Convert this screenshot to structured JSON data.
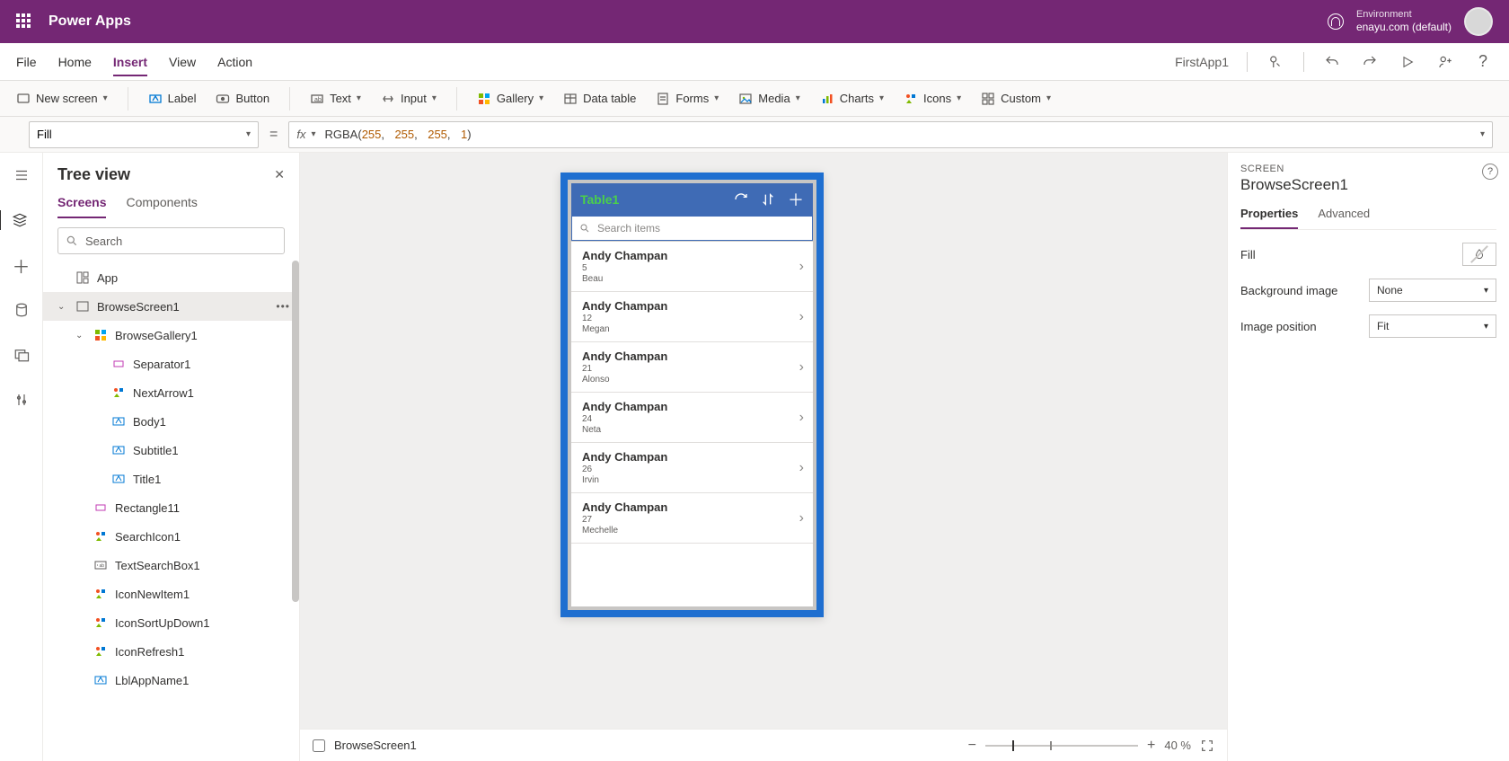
{
  "header": {
    "product": "Power Apps",
    "env_label": "Environment",
    "env_value": "enayu.com (default)"
  },
  "menubar": {
    "items": [
      "File",
      "Home",
      "Insert",
      "View",
      "Action"
    ],
    "active": "Insert",
    "app_name": "FirstApp1"
  },
  "ribbon": {
    "new_screen": "New screen",
    "label": "Label",
    "button": "Button",
    "text": "Text",
    "input": "Input",
    "gallery": "Gallery",
    "data_table": "Data table",
    "forms": "Forms",
    "media": "Media",
    "charts": "Charts",
    "icons": "Icons",
    "custom": "Custom"
  },
  "formula": {
    "property": "Fill",
    "fn": "RGBA",
    "args": [
      "255",
      "255",
      "255",
      "1"
    ]
  },
  "tree": {
    "title": "Tree view",
    "tabs": {
      "screens": "Screens",
      "components": "Components"
    },
    "search_placeholder": "Search",
    "items": [
      {
        "label": "App",
        "depth": 0,
        "icon": "app"
      },
      {
        "label": "BrowseScreen1",
        "depth": 0,
        "icon": "screen",
        "expandable": true,
        "selected": true,
        "more": true
      },
      {
        "label": "BrowseGallery1",
        "depth": 1,
        "icon": "gallery",
        "expandable": true
      },
      {
        "label": "Separator1",
        "depth": 2,
        "icon": "rect"
      },
      {
        "label": "NextArrow1",
        "depth": 2,
        "icon": "icons"
      },
      {
        "label": "Body1",
        "depth": 2,
        "icon": "label"
      },
      {
        "label": "Subtitle1",
        "depth": 2,
        "icon": "label"
      },
      {
        "label": "Title1",
        "depth": 2,
        "icon": "label"
      },
      {
        "label": "Rectangle11",
        "depth": 1,
        "icon": "rect"
      },
      {
        "label": "SearchIcon1",
        "depth": 1,
        "icon": "icons"
      },
      {
        "label": "TextSearchBox1",
        "depth": 1,
        "icon": "textbox"
      },
      {
        "label": "IconNewItem1",
        "depth": 1,
        "icon": "icons"
      },
      {
        "label": "IconSortUpDown1",
        "depth": 1,
        "icon": "icons"
      },
      {
        "label": "IconRefresh1",
        "depth": 1,
        "icon": "icons"
      },
      {
        "label": "LblAppName1",
        "depth": 1,
        "icon": "label"
      }
    ]
  },
  "app_preview": {
    "title": "Table1",
    "search_placeholder": "Search items",
    "rows": [
      {
        "title": "Andy Champan",
        "sub1": "5",
        "sub2": "Beau"
      },
      {
        "title": "Andy Champan",
        "sub1": "12",
        "sub2": "Megan"
      },
      {
        "title": "Andy Champan",
        "sub1": "21",
        "sub2": "Alonso"
      },
      {
        "title": "Andy Champan",
        "sub1": "24",
        "sub2": "Neta"
      },
      {
        "title": "Andy Champan",
        "sub1": "26",
        "sub2": "Irvin"
      },
      {
        "title": "Andy Champan",
        "sub1": "27",
        "sub2": "Mechelle"
      }
    ]
  },
  "status": {
    "screen_label": "BrowseScreen1",
    "zoom": "40 %",
    "zoom_value": 40
  },
  "props": {
    "category": "SCREEN",
    "name": "BrowseScreen1",
    "tabs": {
      "properties": "Properties",
      "advanced": "Advanced"
    },
    "rows": {
      "fill_label": "Fill",
      "bg_label": "Background image",
      "bg_value": "None",
      "pos_label": "Image position",
      "pos_value": "Fit"
    }
  }
}
